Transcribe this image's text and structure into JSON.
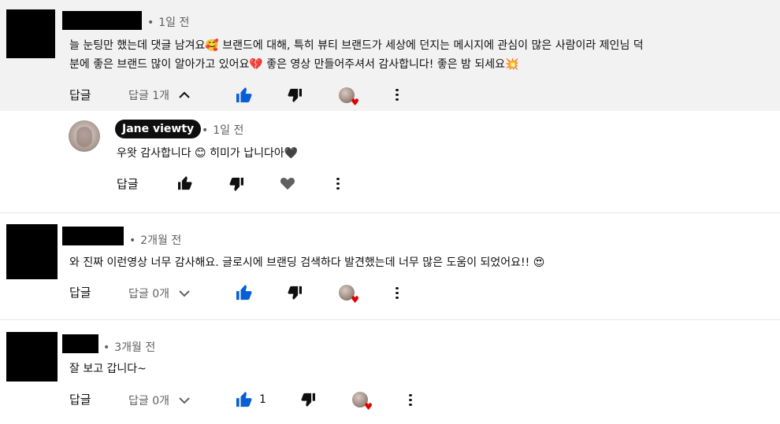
{
  "comments": [
    {
      "time": "1일 전",
      "text_line1": "늘 눈팅만 했는데 댓글 남겨요🥰 브랜드에 대해, 특히 뷰티 브랜드가 세상에 던지는 메시지에 관심이 많은 사람이라 제인님 덕",
      "text_line2": "분에 좋은 브랜드 많이 알아가고 있어요💔 좋은 영상 만들어주셔서 감사합니다! 좋은 밤 되세요💥",
      "reply_label": "답글",
      "replies_label": "답글 1개",
      "like_count": ""
    },
    {
      "time": "2개월 전",
      "text_line1": "와 진짜 이런영상 너무 감사해요. 글로시에 브랜딩 검색하다 발견했는데 너무 많은 도움이 되었어요!! 😍",
      "reply_label": "답글",
      "replies_label": "답글 0개",
      "like_count": ""
    },
    {
      "time": "3개월 전",
      "text_line1": "잘 보고 갑니다~",
      "reply_label": "답글",
      "replies_label": "답글 0개",
      "like_count": "1"
    }
  ],
  "reply": {
    "author": "Jane viewty",
    "time": "1일 전",
    "text": "우왓 감사합니다 😊 히미가 납니다아🖤",
    "reply_label": "답글"
  },
  "icons": {
    "like": "thumbs-up-icon",
    "dislike": "thumbs-down-icon",
    "heart": "heart-icon",
    "more": "more-vert-icon",
    "chevron_up": "chevron-up-icon",
    "chevron_down": "chevron-down-icon"
  },
  "colors": {
    "accent_blue": "#065fd4",
    "heart_red": "#e00000",
    "highlight_bg": "#f2f2f2"
  }
}
